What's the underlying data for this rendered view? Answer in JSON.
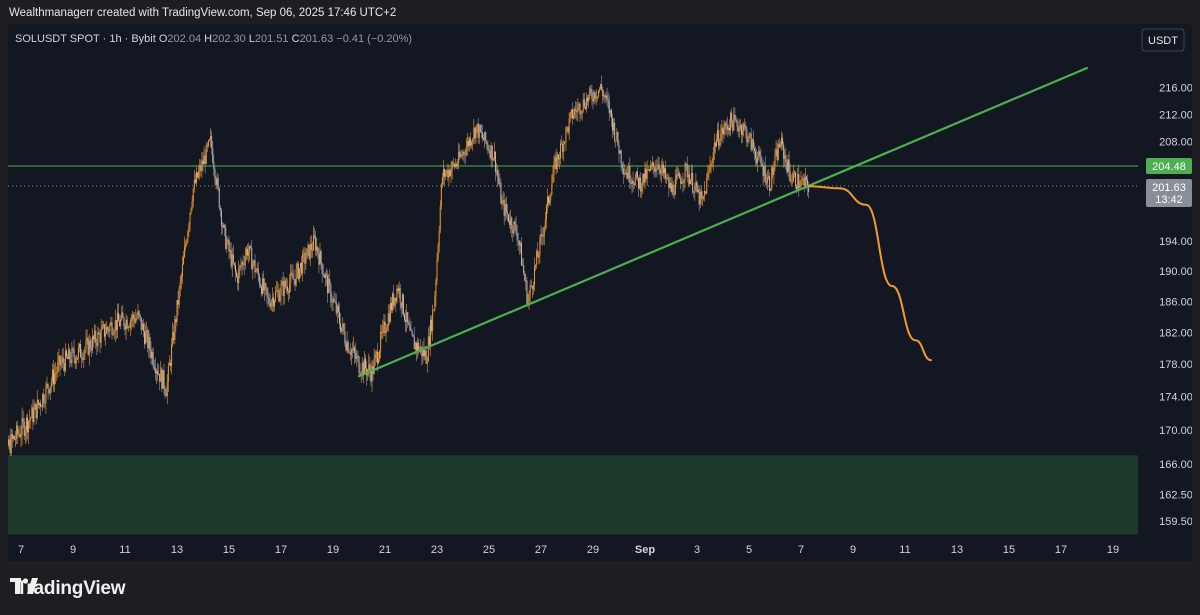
{
  "header": {
    "credit": "Wealthmanagerr created with TradingView.com, Sep 06, 2025 17:46 UTC+2"
  },
  "legend": {
    "symbol": "SOLUSDT SPOT · 1h · Bybit",
    "o_label": "O",
    "o_value": "202.04",
    "h_label": "H",
    "h_value": "202.30",
    "l_label": "L",
    "l_value": "201.51",
    "c_label": "C",
    "c_value": "201.63",
    "change": "−0.41 (−0.20%)"
  },
  "currency_button": "USDT",
  "footer": {
    "brand": "TradingView"
  },
  "colors": {
    "candle": "#f39a2d",
    "trendline": "#4caf50",
    "level_line": "#4caf50",
    "projection": "#f39a2d",
    "support_zone": "#1e3a2b",
    "axis_text": "#d1d4dc"
  },
  "chart_data": {
    "type": "candlestick",
    "title": "SOLUSDT SPOT · 1h · Bybit",
    "x_tick_labels": [
      "7",
      "9",
      "11",
      "13",
      "15",
      "17",
      "19",
      "21",
      "23",
      "25",
      "27",
      "29",
      "Sep",
      "3",
      "5",
      "7",
      "9",
      "11",
      "13",
      "15",
      "17",
      "19"
    ],
    "y_tick_labels": [
      "216.00",
      "212.00",
      "208.00",
      "194.00",
      "190.00",
      "186.00",
      "182.00",
      "178.00",
      "174.00",
      "170.00",
      "166.00",
      "162.50",
      "159.50"
    ],
    "y_scale": "log",
    "y_range": [
      158,
      220
    ],
    "grid": false,
    "price_path": [
      [
        "Aug 6",
        163
      ],
      [
        "Aug 6.5",
        168
      ],
      [
        "Aug 7.5",
        172
      ],
      [
        "Aug 8.5",
        178
      ],
      [
        "Aug 9.5",
        180
      ],
      [
        "Aug 10.5",
        183
      ],
      [
        "Aug 11.5",
        184
      ],
      [
        "Aug 12.3",
        177
      ],
      [
        "Aug 12.6",
        175
      ],
      [
        "Aug 13.2",
        190
      ],
      [
        "Aug 13.6",
        201
      ],
      [
        "Aug 14.3",
        208
      ],
      [
        "Aug 14.8",
        195
      ],
      [
        "Aug 15.3",
        189
      ],
      [
        "Aug 15.7",
        193
      ],
      [
        "Aug 16.5",
        186
      ],
      [
        "Aug 17.5",
        189
      ],
      [
        "Aug 18.3",
        194
      ],
      [
        "Aug 18.8",
        188
      ],
      [
        "Aug 19.5",
        181
      ],
      [
        "Aug 20",
        178
      ],
      [
        "Aug 20.5",
        177
      ],
      [
        "Aug 21.2",
        185
      ],
      [
        "Aug 21.5",
        188
      ],
      [
        "Aug 22",
        181
      ],
      [
        "Aug 22.6",
        179
      ],
      [
        "Aug 22.9",
        186
      ],
      [
        "Aug 23.2",
        203
      ],
      [
        "Aug 23.8",
        205
      ],
      [
        "Aug 24.5",
        210
      ],
      [
        "Aug 25.2",
        206
      ],
      [
        "Aug 25.5",
        199
      ],
      [
        "Aug 26.1",
        195
      ],
      [
        "Aug 26.5",
        186
      ],
      [
        "Aug 27",
        194
      ],
      [
        "Aug 27.5",
        204
      ],
      [
        "Aug 28.2",
        212
      ],
      [
        "Aug 28.7",
        214
      ],
      [
        "Aug 29.3",
        216
      ],
      [
        "Aug 29.6",
        213
      ],
      [
        "Aug 30.2",
        204
      ],
      [
        "Aug 30.8",
        202
      ],
      [
        "Aug 31.5",
        205
      ],
      [
        "Sep 1",
        201
      ],
      [
        "Sep 1.6",
        204
      ],
      [
        "Sep 2.2",
        199
      ],
      [
        "Sep 2.7",
        208
      ],
      [
        "Sep 3.3",
        211
      ],
      [
        "Sep 3.8",
        210
      ],
      [
        "Sep 4.3",
        206
      ],
      [
        "Sep 4.8",
        202
      ],
      [
        "Sep 5.2",
        208
      ],
      [
        "Sep 5.6",
        203
      ],
      [
        "Sep 6",
        202
      ],
      [
        "Sep 6.3",
        201.63
      ]
    ],
    "horizontal_level": {
      "value": 204.48,
      "label": "204.48"
    },
    "last_price": {
      "value": 201.63,
      "label": "201.63",
      "countdown": "13:42"
    },
    "trendline": {
      "from": [
        "Aug 20",
        176.5
      ],
      "to": [
        "Sep 17",
        219
      ]
    },
    "support_zone": {
      "from_value": 158,
      "to_value": 167
    },
    "projection": [
      [
        "Sep 6.3",
        201.6
      ],
      [
        "Sep 7.5",
        201.3
      ],
      [
        "Sep 8.5",
        199
      ],
      [
        "Sep 9.5",
        188
      ],
      [
        "Sep 10.4",
        181
      ],
      [
        "Sep 11",
        178.5
      ]
    ]
  }
}
